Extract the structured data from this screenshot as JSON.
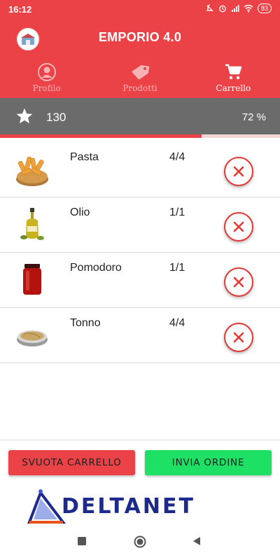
{
  "status_bar": {
    "time": "16:12",
    "battery": "83"
  },
  "header": {
    "title": "EMPORIO 4.0",
    "logo_icon": "store-logo"
  },
  "tabs": [
    {
      "label": "Profilo",
      "icon": "person-icon",
      "active": false
    },
    {
      "label": "Prodotti",
      "icon": "tag-icon",
      "active": false
    },
    {
      "label": "Carrello",
      "icon": "cart-icon",
      "active": true
    }
  ],
  "points": {
    "value": "130",
    "percent_label": "72 %",
    "progress": 0.72
  },
  "cart": {
    "items": [
      {
        "name": "Pasta",
        "qty": "4/4",
        "image": "pasta"
      },
      {
        "name": "Olio",
        "qty": "1/1",
        "image": "oil"
      },
      {
        "name": "Pomodoro",
        "qty": "1/1",
        "image": "tomato-jar"
      },
      {
        "name": "Tonno",
        "qty": "4/4",
        "image": "tuna-can"
      }
    ]
  },
  "actions": {
    "clear_label": "SVUOTA CARRELLO",
    "send_label": "INVIA ORDINE"
  },
  "brand": {
    "name": "DELTANET"
  },
  "colors": {
    "primary": "#ea4246",
    "progress_bg": "#6b6b6b",
    "send": "#1ee065",
    "brand": "#1c2a8c"
  }
}
